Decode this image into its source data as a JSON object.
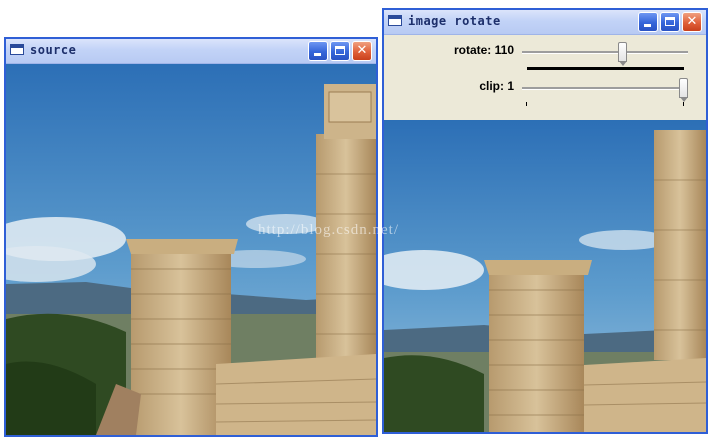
{
  "source_window": {
    "title": "source",
    "title_icon": "window-icon",
    "buttons": [
      "minimize-icon",
      "maximize-icon",
      "close-icon"
    ]
  },
  "rotate_window": {
    "title": "image rotate",
    "title_icon": "window-icon",
    "buttons": [
      "minimize-icon",
      "maximize-icon",
      "close-icon"
    ],
    "trackbars": [
      {
        "label": "rotate: 110",
        "value": 110,
        "max": 180
      },
      {
        "label": "clip: 1",
        "value": 1,
        "max": 1
      }
    ]
  },
  "watermark": "http://blog.csdn.net/",
  "colors": {
    "title_active": "#2f5fd6",
    "panel_bg": "#ece9d8",
    "close_button": "#e0603a"
  }
}
